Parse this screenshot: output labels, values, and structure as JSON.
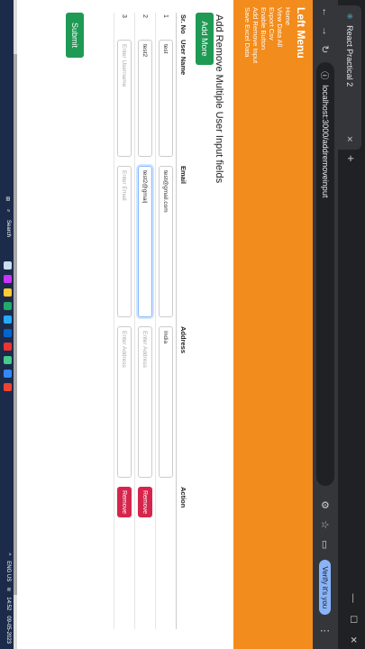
{
  "browser": {
    "tab_title": "React Practical 2",
    "url": "localhost:3000/addremoveinput",
    "profile_label": "Verify it's you"
  },
  "sidebar": {
    "title": "Left Menu",
    "items": [
      "Home",
      "View Data All",
      "Export Csv",
      "Enable Button",
      "Add Remove Input",
      "Save Excel Data"
    ]
  },
  "main": {
    "heading": "Add Remove Multiple User Input fields",
    "add_more_label": "Add More",
    "columns": [
      "Sr. No",
      "User Name",
      "Email",
      "Address",
      "Action"
    ],
    "rows": [
      {
        "sr": "1",
        "username": "test",
        "email": "test@gmail.com",
        "address": "India",
        "action": ""
      },
      {
        "sr": "2",
        "username": "test2",
        "email": "test2@gmai|",
        "address": "",
        "action": "Remove"
      },
      {
        "sr": "3",
        "username": "",
        "email": "",
        "address": "",
        "action": "Remove"
      }
    ],
    "placeholders": {
      "username": "Enter Username",
      "email": "Enter Email",
      "address": "Enter Address"
    },
    "submit_label": "Submit"
  },
  "taskbar": {
    "search_label": "Search",
    "lang": "ENG\nUS",
    "time": "14:52",
    "date": "09-05-2023"
  },
  "colors": {
    "sidebar": "#f28c1d",
    "primary_green": "#1e9a55",
    "danger_red": "#d6254c"
  }
}
